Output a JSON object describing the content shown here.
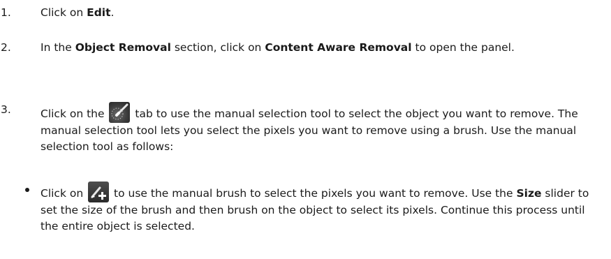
{
  "steps": [
    {
      "number": "1.",
      "pre": "Click on ",
      "bold": "Edit",
      "post": "."
    },
    {
      "number": "2.",
      "pre": "In the ",
      "bold1": "Object Removal",
      "mid": " section, click on ",
      "bold2": "Content Aware Removal",
      "post": " to open the panel."
    },
    {
      "number": "3.",
      "pre": "Click on the ",
      "icon": "manual-selection-brush-icon",
      "post": " tab to use the manual selection tool to select the object you want to remove. The manual selection tool lets you select the pixels you want to remove using a brush. Use the manual selection tool as follows:"
    }
  ],
  "bullet": {
    "pre": "Click on ",
    "icon": "add-brush-icon",
    "mid": " to use the manual brush to select the pixels you want to remove. Use the ",
    "bold": "Size",
    "post": " slider to set the size of the brush and then brush on the object to select its pixels. Continue this process until the entire object is selected."
  }
}
